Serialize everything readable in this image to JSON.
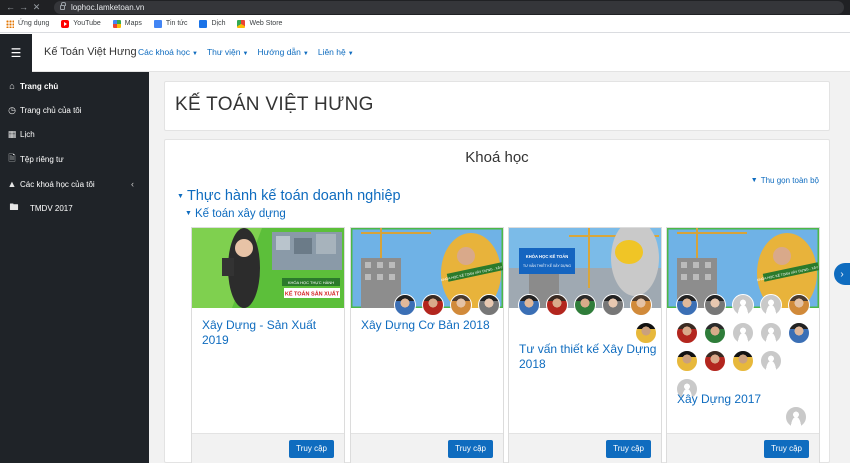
{
  "browser": {
    "url": "lophoc.lamketoan.vn",
    "bookmarks": [
      {
        "label": "Ứng dụng",
        "icon": "apps-icon"
      },
      {
        "label": "YouTube",
        "icon": "youtube-icon"
      },
      {
        "label": "Maps",
        "icon": "maps-icon"
      },
      {
        "label": "Tin tức",
        "icon": "news-icon"
      },
      {
        "label": "Dịch",
        "icon": "translate-icon"
      },
      {
        "label": "Web Store",
        "icon": "webstore-icon"
      }
    ]
  },
  "navbar": {
    "brand": "Kế Toán Việt Hưng",
    "menu": [
      "Các khoá học",
      "Thư viện",
      "Hướng dẫn",
      "Liên hệ"
    ]
  },
  "sidebar": {
    "items": [
      {
        "label": "Trang chủ",
        "icon": "home-icon"
      },
      {
        "label": "Trang chủ của tôi",
        "icon": "dashboard-icon"
      },
      {
        "label": "Lịch",
        "icon": "calendar-icon"
      },
      {
        "label": "Tệp riêng tư",
        "icon": "file-icon"
      },
      {
        "label": "Các khoá học của tôi",
        "icon": "graduation-cap-icon"
      },
      {
        "label": "TMDV 2017",
        "icon": "folder-icon"
      }
    ]
  },
  "header": {
    "site_title": "KẾ TOÁN VIỆT HƯNG"
  },
  "courses_section": {
    "title": "Khoá học",
    "collapse_all": "Thu gọn toàn bộ",
    "category": "Thực hành kế toán doanh nghiệp",
    "subcategory": "Kế toán xây dựng",
    "courses": [
      {
        "name": "Xây Dựng - Sản Xuất 2019",
        "button": "Truy cập",
        "banner_text": "KẾ TOÁN SẢN XUẤT",
        "banner_sub": "KHÓA HỌC THỰC HÀNH"
      },
      {
        "name": "Xây Dựng Cơ Bản 2018",
        "button": "Truy cập",
        "banner_text": "KHÓA HỌC KẾ TOÁN XÂY DỰNG - XÂY LẮP"
      },
      {
        "name": "Tư vấn thiết kế Xây Dựng 2018",
        "button": "Truy cập",
        "banner_text": "KHÓA HỌC KẾ TOÁN",
        "banner_sub": "TƯ VẤN THIẾT KẾ XÂY DỰNG"
      },
      {
        "name": "Xây Dựng 2017",
        "button": "Truy cập",
        "banner_text": "KHÓA HỌC KẾ TOÁN XÂY DỰNG - XÂY LẮP"
      }
    ]
  },
  "colors": {
    "link": "#0f6cbf",
    "sidebar_bg": "#1f2328",
    "accent_green": "#4cb848"
  }
}
